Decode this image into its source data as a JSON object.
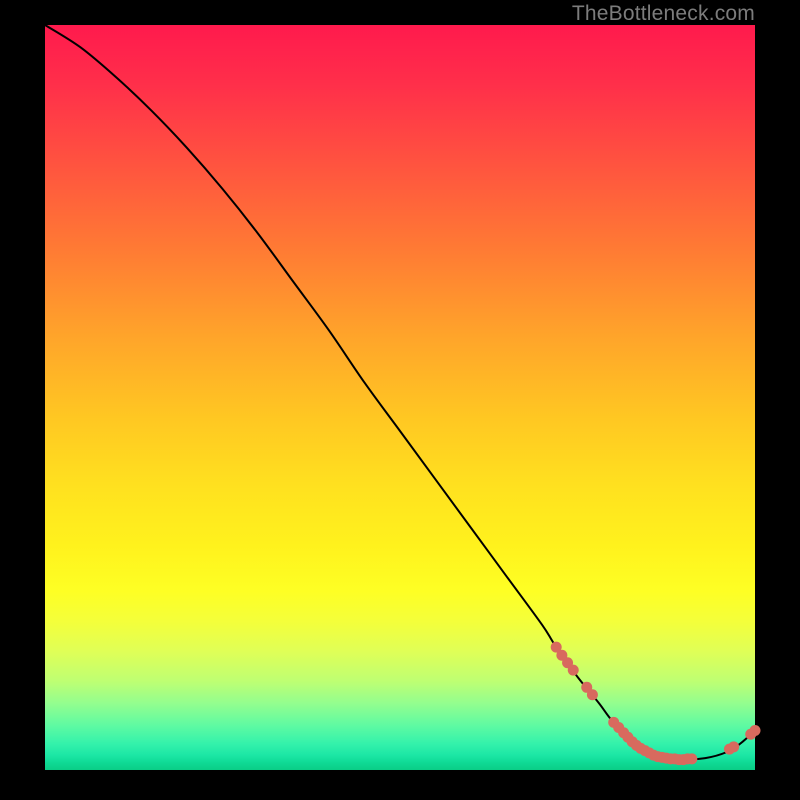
{
  "watermark": "TheBottleneck.com",
  "chart_data": {
    "type": "line",
    "title": "",
    "xlabel": "",
    "ylabel": "",
    "xlim": [
      0,
      100
    ],
    "ylim": [
      0,
      100
    ],
    "grid": false,
    "series": [
      {
        "name": "bottleneck-curve",
        "color": "#000000",
        "x": [
          0,
          5,
          10,
          15,
          20,
          25,
          30,
          35,
          40,
          45,
          50,
          55,
          60,
          65,
          70,
          72,
          75,
          78,
          80,
          83,
          86,
          90,
          93,
          96,
          98,
          100
        ],
        "y": [
          100,
          97,
          93,
          88.5,
          83.5,
          78,
          72,
          65.5,
          59,
          52,
          45.5,
          39,
          32.5,
          26,
          19.5,
          16.5,
          12.5,
          9,
          6.5,
          4,
          2.4,
          1.5,
          1.6,
          2.4,
          3.6,
          5.3
        ]
      }
    ],
    "markers": {
      "name": "highlight-points",
      "color": "#d86a5e",
      "radius": 5.5,
      "points": [
        {
          "x": 72.0,
          "y": 16.5
        },
        {
          "x": 72.8,
          "y": 15.4
        },
        {
          "x": 73.6,
          "y": 14.4
        },
        {
          "x": 74.4,
          "y": 13.4
        },
        {
          "x": 76.3,
          "y": 11.1
        },
        {
          "x": 77.1,
          "y": 10.1
        },
        {
          "x": 80.1,
          "y": 6.4
        },
        {
          "x": 80.8,
          "y": 5.7
        },
        {
          "x": 81.5,
          "y": 5.0
        },
        {
          "x": 82.1,
          "y": 4.4
        },
        {
          "x": 82.7,
          "y": 3.8
        },
        {
          "x": 83.3,
          "y": 3.3
        },
        {
          "x": 83.9,
          "y": 2.9
        },
        {
          "x": 84.5,
          "y": 2.6
        },
        {
          "x": 85.1,
          "y": 2.3
        },
        {
          "x": 85.7,
          "y": 2.0
        },
        {
          "x": 86.3,
          "y": 1.8
        },
        {
          "x": 86.9,
          "y": 1.7
        },
        {
          "x": 87.5,
          "y": 1.6
        },
        {
          "x": 88.1,
          "y": 1.5
        },
        {
          "x": 88.7,
          "y": 1.5
        },
        {
          "x": 89.3,
          "y": 1.4
        },
        {
          "x": 89.9,
          "y": 1.4
        },
        {
          "x": 90.5,
          "y": 1.5
        },
        {
          "x": 91.1,
          "y": 1.5
        },
        {
          "x": 96.4,
          "y": 2.8
        },
        {
          "x": 97.0,
          "y": 3.1
        },
        {
          "x": 99.4,
          "y": 4.8
        },
        {
          "x": 100.0,
          "y": 5.3
        }
      ]
    }
  }
}
